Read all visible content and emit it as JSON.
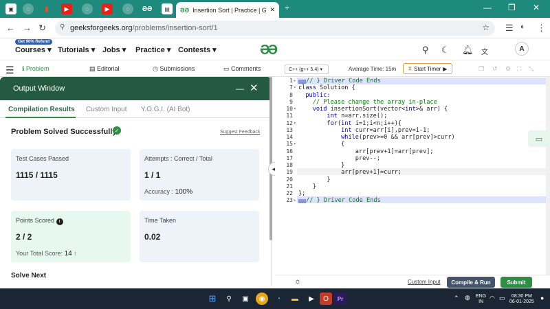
{
  "browser": {
    "active_tab_title": "Insertion Sort | Practice | GeeksforGeeks",
    "url_domain": "geeksforgeeks.org",
    "url_path": "/problems/insertion-sort/1",
    "new_tab_symbol": "+"
  },
  "site": {
    "refund_badge": "Get 90% Refund",
    "menu": [
      "Courses",
      "Tutorials",
      "Jobs",
      "Practice",
      "Contests"
    ],
    "logo_text": "GG",
    "avatar_initial": "A"
  },
  "left_tabs": [
    "Problem",
    "Editorial",
    "Submissions",
    "Comments"
  ],
  "output": {
    "title": "Output Window",
    "tabs": [
      "Compilation Results",
      "Custom Input",
      "Y.O.G.I. (AI Bot)"
    ],
    "status": "Problem Solved Successfully",
    "suggest_feedback": "Suggest Feedback",
    "test_cases_label": "Test Cases Passed",
    "test_cases_value": "1115 / 1115",
    "attempts_label": "Attempts : Correct / Total",
    "attempts_value": "1 / 1",
    "accuracy_label": "Accuracy :",
    "accuracy_value": "100%",
    "points_label": "Points Scored",
    "points_value": "2 / 2",
    "total_score_label": "Your Total Score:",
    "total_score_value": "14",
    "time_label": "Time Taken",
    "time_value": "0.02",
    "solve_next": "Solve Next"
  },
  "editor": {
    "language": "C++ (g++ 5.4)",
    "average_time": "Average Time: 15m",
    "start_timer": "Start Timer",
    "lines": [
      {
        "n": "1",
        "fold": "▸",
        "tag": "true",
        "text": "// } Driver Code Ends"
      },
      {
        "n": "7",
        "fold": "▾",
        "tag": "",
        "text": "class Solution {"
      },
      {
        "n": "8",
        "fold": "",
        "tag": "",
        "text": "  public:"
      },
      {
        "n": "9",
        "fold": "",
        "tag": "",
        "text": "    // Please change the array in-place"
      },
      {
        "n": "10",
        "fold": "▾",
        "tag": "",
        "text": "    void insertionSort(vector<int>& arr) {"
      },
      {
        "n": "11",
        "fold": "",
        "tag": "",
        "text": "        int n=arr.size();"
      },
      {
        "n": "12",
        "fold": "▾",
        "tag": "",
        "text": "        for(int i=1;i<n;i++){"
      },
      {
        "n": "13",
        "fold": "",
        "tag": "",
        "text": "            int curr=arr[i],prev=i-1;"
      },
      {
        "n": "14",
        "fold": "",
        "tag": "",
        "text": "            while(prev>=0 && arr[prev]>curr)"
      },
      {
        "n": "15",
        "fold": "▾",
        "tag": "",
        "text": "            {"
      },
      {
        "n": "16",
        "fold": "",
        "tag": "",
        "text": "                arr[prev+1]=arr[prev];"
      },
      {
        "n": "17",
        "fold": "",
        "tag": "",
        "text": "                prev--;"
      },
      {
        "n": "18",
        "fold": "",
        "tag": "",
        "text": "            }"
      },
      {
        "n": "19",
        "fold": "",
        "tag": "",
        "text": "            arr[prev+1]=curr;"
      },
      {
        "n": "20",
        "fold": "",
        "tag": "",
        "text": "        }"
      },
      {
        "n": "21",
        "fold": "",
        "tag": "",
        "text": "    }"
      },
      {
        "n": "22",
        "fold": "",
        "tag": "",
        "text": "};"
      },
      {
        "n": "23",
        "fold": "▸",
        "tag": "true",
        "text": "// } Driver Code Ends"
      }
    ],
    "custom_input": "Custom Input",
    "compile_run": "Compile & Run",
    "submit": "Submit"
  },
  "taskbar": {
    "lang_line1": "ENG",
    "lang_line2": "IN",
    "time": "08:30 PM",
    "date": "06-01-2025"
  },
  "colors": {
    "brand_green": "#2f8d46",
    "output_header": "#235a40",
    "tab_strip": "#1d8a7d"
  }
}
